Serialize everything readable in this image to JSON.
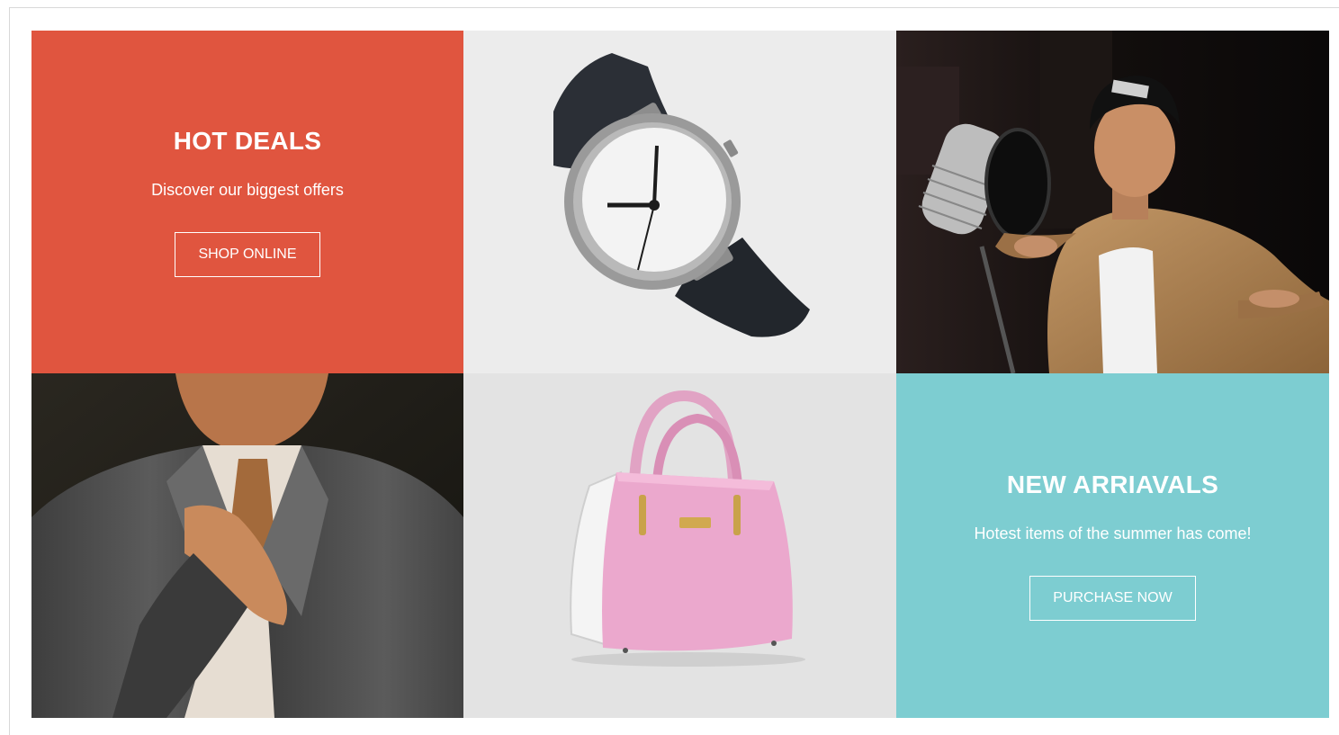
{
  "promo_hot": {
    "title": "HOT DEALS",
    "subtitle": "Discover our biggest offers",
    "button": "SHOP ONLINE",
    "bg_color": "#e0553f"
  },
  "promo_new": {
    "title": "NEW ARRIAVALS",
    "subtitle": "Hotest items of the summer has come!",
    "button": "PURCHASE NOW",
    "bg_color": "#7dcdd1"
  },
  "images": [
    {
      "name": "watch-image",
      "icon": "wristwatch"
    },
    {
      "name": "singer-image",
      "icon": "man-with-microphone"
    },
    {
      "name": "suit-image",
      "icon": "man-in-suit"
    },
    {
      "name": "handbag-image",
      "icon": "pink-handbag"
    }
  ],
  "colors": {
    "light_tile": "#ececec",
    "dark_tile": "#1e1c18"
  }
}
